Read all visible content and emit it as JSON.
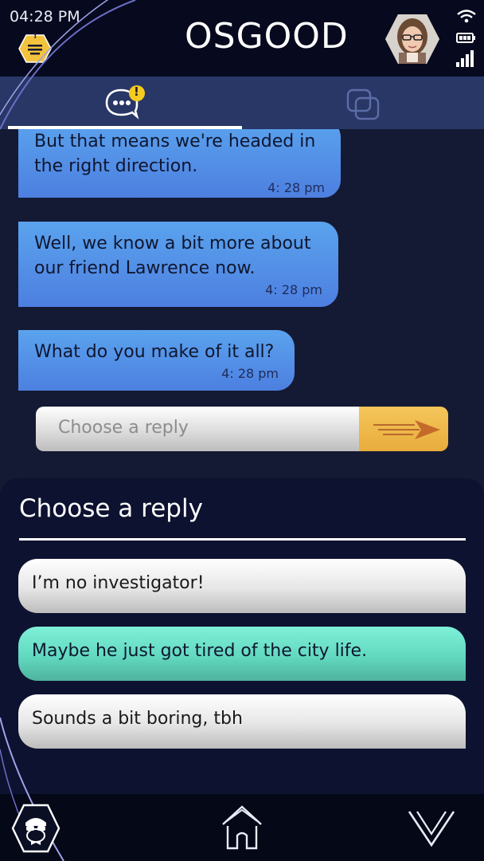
{
  "status": {
    "time": "04:28 PM"
  },
  "header": {
    "contact_name": "OSGOOD",
    "menu_badge": "!"
  },
  "tabs": {
    "chat_badge": "!"
  },
  "messages": [
    {
      "text": "But that means we're headed in\nthe right direction.",
      "time": "4: 28 pm"
    },
    {
      "text": "Well, we know a bit more about\nour friend Lawrence now.",
      "time": "4: 28 pm"
    },
    {
      "text": "What do you make of it all?",
      "time": "4: 28 pm"
    }
  ],
  "reply_box": {
    "placeholder": "Choose a reply"
  },
  "choices_panel": {
    "title": "Choose a reply",
    "options": [
      {
        "label": "I’m no investigator!"
      },
      {
        "label": "Maybe he just got tired of the city life."
      },
      {
        "label": "Sounds a bit boring, tbh"
      }
    ]
  },
  "colors": {
    "background": "#141a33",
    "bubble": "#5aa3ee",
    "tabbar": "#283766",
    "accent_yellow": "#f5c65a",
    "highlight_choice": "#7ff0d8"
  }
}
